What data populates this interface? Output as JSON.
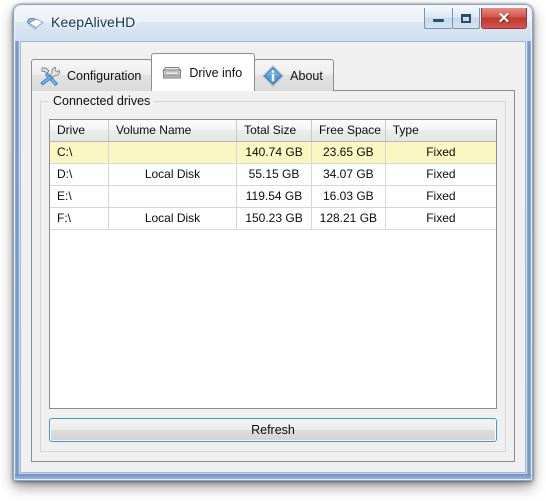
{
  "window": {
    "title": "KeepAliveHD",
    "icon": "drive-icon",
    "buttons": {
      "minimize": "minimize-button",
      "maximize": "maximize-button",
      "close_label": "✕"
    }
  },
  "tabs": [
    {
      "label": "Configuration",
      "icon": "tools-icon",
      "selected": false
    },
    {
      "label": "Drive info",
      "icon": "hard-drive-icon",
      "selected": true
    },
    {
      "label": "About",
      "icon": "info-icon",
      "selected": false
    }
  ],
  "groupbox": {
    "title": "Connected drives"
  },
  "drives_table": {
    "columns": [
      "Drive",
      "Volume Name",
      "Total Size",
      "Free Space",
      "Type"
    ],
    "rows": [
      {
        "drive": "C:\\",
        "volume": "",
        "total": "140.74 GB",
        "free": "23.65 GB",
        "type": "Fixed",
        "selected": true
      },
      {
        "drive": "D:\\",
        "volume": "Local Disk",
        "total": "55.15 GB",
        "free": "34.07 GB",
        "type": "Fixed",
        "selected": false
      },
      {
        "drive": "E:\\",
        "volume": "",
        "total": "119.54 GB",
        "free": "16.03 GB",
        "type": "Fixed",
        "selected": false
      },
      {
        "drive": "F:\\",
        "volume": "Local Disk",
        "total": "150.23 GB",
        "free": "128.21 GB",
        "type": "Fixed",
        "selected": false
      }
    ]
  },
  "buttons": {
    "refresh": "Refresh"
  },
  "colors": {
    "selection_row": "#fbf7c3",
    "focus_border": "#3c9ad6",
    "title_text": "#14314f",
    "close_button": "#bd3a30"
  }
}
